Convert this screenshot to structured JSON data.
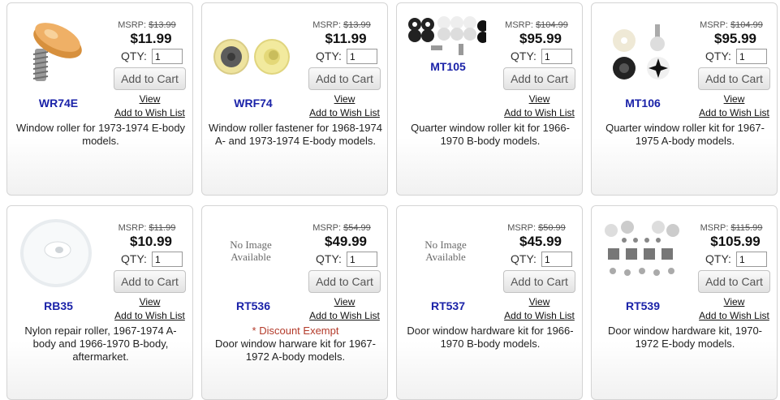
{
  "labels": {
    "msrp": "MSRP:",
    "qty": "QTY:",
    "add_to_cart": "Add to Cart",
    "view": "View",
    "wish": "Add to Wish List",
    "qty_default": "1"
  },
  "products": [
    {
      "sku": "WR74E",
      "msrp": "$13.99",
      "price": "$11.99",
      "desc": "Window roller for 1973-1974 E-body models.",
      "image": "roller-icon"
    },
    {
      "sku": "WRF74",
      "msrp": "$13.99",
      "price": "$11.99",
      "desc": "Window roller fastener for 1968-1974 A- and 1973-1974 E-body models.",
      "image": "fastener-icon"
    },
    {
      "sku": "MT105",
      "msrp": "$104.99",
      "price": "$95.99",
      "desc": "Quarter window roller kit for 1966-1970 B-body models.",
      "image": "kit-icon"
    },
    {
      "sku": "MT106",
      "msrp": "$104.99",
      "price": "$95.99",
      "desc": "Quarter window roller kit for 1967-1975 A-body models.",
      "image": "kit-icon"
    },
    {
      "sku": "RB35",
      "msrp": "$11.99",
      "price": "$10.99",
      "desc": "Nylon repair roller, 1967-1974 A-body and 1966-1970 B-body, aftermarket.",
      "image": "nylon-roller-icon"
    },
    {
      "sku": "RT536",
      "msrp": "$54.99",
      "price": "$49.99",
      "desc": "Door window harware kit for 1967-1972 A-body models.",
      "exempt": "* Discount Exempt",
      "image": "no-image",
      "noimg": "No Image Available"
    },
    {
      "sku": "RT537",
      "msrp": "$50.99",
      "price": "$45.99",
      "desc": "Door window hardware kit for 1966-1970 B-body models.",
      "image": "no-image",
      "noimg": "No Image Available"
    },
    {
      "sku": "RT539",
      "msrp": "$115.99",
      "price": "$105.99",
      "desc": "Door window hardware kit, 1970-1972 E-body models.",
      "image": "hardware-kit-icon"
    }
  ]
}
